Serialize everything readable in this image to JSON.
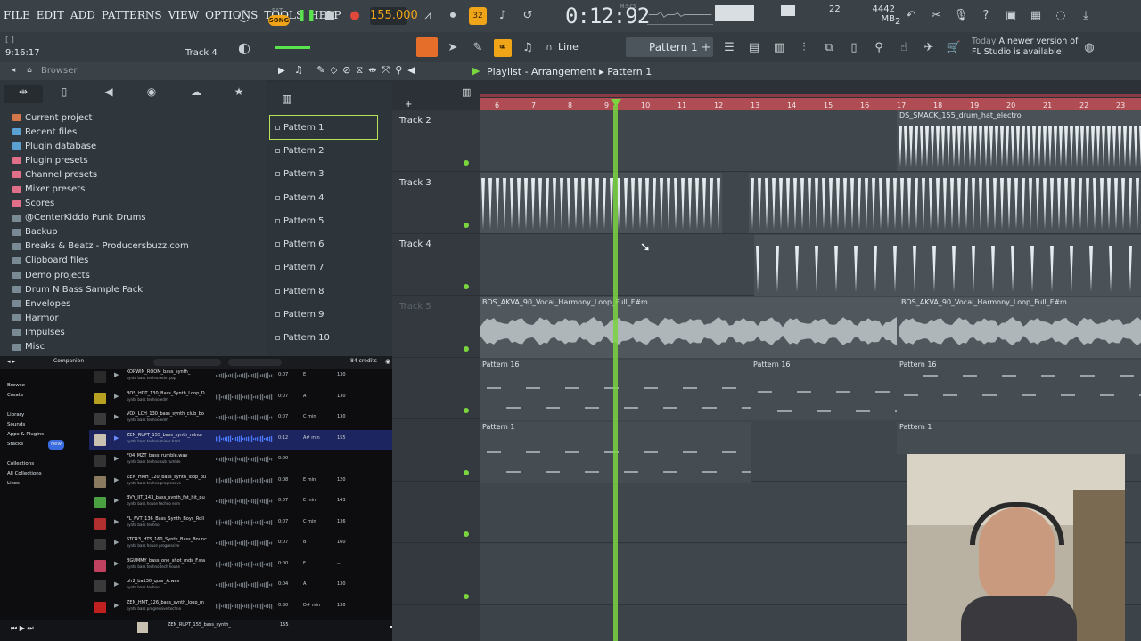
{
  "menu": [
    "FILE",
    "EDIT",
    "ADD",
    "PATTERNS",
    "VIEW",
    "OPTIONS",
    "TOOLS",
    "HELP"
  ],
  "transport": {
    "pat_label": "PAT",
    "song_label": "SONG",
    "tempo": "155.000",
    "time": "0:12:92",
    "time_unit": "M:S:CS",
    "mem": "4442 MB",
    "cpu_num": "22",
    "poly": "2"
  },
  "hint_bar": {
    "hint": "[ ]",
    "position": "9:16:17",
    "track": "Track 4"
  },
  "toolbar2": {
    "snap": "Line",
    "pattern": "Pattern 1"
  },
  "news": {
    "when": "Today",
    "text1": "A newer version of",
    "text2": "FL Studio is available!"
  },
  "browser": {
    "title": "Browser",
    "items": [
      {
        "label": "Current project",
        "color": "#d2784a"
      },
      {
        "label": "Recent files",
        "color": "#5aa0d0"
      },
      {
        "label": "Plugin database",
        "color": "#5aa0d0"
      },
      {
        "label": "Plugin presets",
        "color": "#e0708a"
      },
      {
        "label": "Channel presets",
        "color": "#e0708a"
      },
      {
        "label": "Mixer presets",
        "color": "#e0708a"
      },
      {
        "label": "Scores",
        "color": "#e0708a"
      },
      {
        "label": "@CenterKiddo Punk Drums",
        "color": "#7a8a94"
      },
      {
        "label": "Backup",
        "color": "#7a8a94"
      },
      {
        "label": "Breaks & Beatz - Producersbuzz.com",
        "color": "#7a8a94"
      },
      {
        "label": "Clipboard files",
        "color": "#7a8a94"
      },
      {
        "label": "Demo projects",
        "color": "#7a8a94"
      },
      {
        "label": "Drum N Bass Sample Pack",
        "color": "#7a8a94"
      },
      {
        "label": "Envelopes",
        "color": "#7a8a94"
      },
      {
        "label": "Harmor",
        "color": "#7a8a94"
      },
      {
        "label": "Impulses",
        "color": "#7a8a94"
      },
      {
        "label": "Misc",
        "color": "#7a8a94"
      }
    ]
  },
  "companion": {
    "title": "Companion",
    "credits": "84 credits",
    "nav": [
      "Browse",
      "Create",
      "",
      "Library",
      "Sounds",
      "Apps & Plugins",
      "Stacks",
      "",
      "Collections",
      "All Collections",
      "Likes"
    ],
    "new_badge": "New",
    "rows": [
      {
        "name": "KORWIN_ROOM_bass_synth_",
        "tags": "synth  bass  techno  edm  pop",
        "dur": "0:07",
        "key": "E",
        "bpm": "130",
        "thumb": "#2a2a2a",
        "sel": false
      },
      {
        "name": "BOS_HDT_130_Bass_Synth_Loop_D",
        "tags": "synth  bass  techno  edm",
        "dur": "0:07",
        "key": "A",
        "bpm": "130",
        "thumb": "#b8a020",
        "sel": false
      },
      {
        "name": "VOX_LCH_130_bass_synth_club_bo",
        "tags": "synth  bass  techno  edm",
        "dur": "0:07",
        "key": "C min",
        "bpm": "130",
        "thumb": "#3a3a3a",
        "sel": false
      },
      {
        "name": "ZEN_RUPT_155_bass_synth_minor",
        "tags": "synth  bass  techno  minor  hard",
        "dur": "0:12",
        "key": "A# min",
        "bpm": "155",
        "thumb": "#c8c0b0",
        "sel": true
      },
      {
        "name": "F04_MZT_bass_rumble.wav",
        "tags": "synth  bass  techno  sub  rumble",
        "dur": "0:00",
        "key": "--",
        "bpm": "--",
        "thumb": "#333333",
        "sel": false
      },
      {
        "name": "ZEN_HMH_120_bass_synth_loop_pu",
        "tags": "synth  bass  techno  progressive",
        "dur": "0:08",
        "key": "E min",
        "bpm": "120",
        "thumb": "#8a7a60",
        "sel": false
      },
      {
        "name": "BVY_IIT_143_bass_synth_fat_hit_pu",
        "tags": "synth  bass  house  techno  edm",
        "dur": "0:07",
        "key": "E min",
        "bpm": "143",
        "thumb": "#4aa040",
        "sel": false
      },
      {
        "name": "FL_PVT_136_Bass_Synth_Boys_Roll",
        "tags": "synth  bass  techno",
        "dur": "0:07",
        "key": "C min",
        "bpm": "136",
        "thumb": "#b03030",
        "sel": false
      },
      {
        "name": "STCR3_HTS_160_Synth_Bass_Bounc",
        "tags": "synth  bass  house  progressive",
        "dur": "0:07",
        "key": "B",
        "bpm": "160",
        "thumb": "#3a3a3a",
        "sel": false
      },
      {
        "name": "BGUMMY_bass_one_shot_mds_F.wa",
        "tags": "synth  bass  techno  tech house",
        "dur": "0:00",
        "key": "F",
        "bpm": "--",
        "thumb": "#c04060",
        "sel": false
      },
      {
        "name": "blr2_ba130_quar_A.wav",
        "tags": "synth  bass  techno",
        "dur": "0:04",
        "key": "A",
        "bpm": "130",
        "thumb": "#3a3a3a",
        "sel": false
      },
      {
        "name": "ZEN_HMT_126_bass_synth_loop_m",
        "tags": "synth  bass  progressive  techno",
        "dur": "0:30",
        "key": "D# min",
        "bpm": "130",
        "thumb": "#c02020",
        "sel": false
      }
    ],
    "footer_file": "ZEN_RUPT_155_bass_synth_",
    "footer_bpm": "155"
  },
  "playlist": {
    "title": "Playlist - Arrangement",
    "pattern": "Pattern 1",
    "patterns": [
      "Pattern 1",
      "Pattern 2",
      "Pattern 3",
      "Pattern 4",
      "Pattern 5",
      "Pattern 6",
      "Pattern 7",
      "Pattern 8",
      "Pattern 9",
      "Pattern 10"
    ],
    "tracks": [
      "Track 2",
      "Track 3",
      "Track 4",
      "Track 5",
      "",
      "",
      "",
      ""
    ],
    "ruler": [
      "6",
      "7",
      "8",
      "9",
      "10",
      "11",
      "12",
      "13",
      "14",
      "15",
      "16",
      "17",
      "18",
      "19",
      "20",
      "21",
      "22",
      "23"
    ],
    "clips": {
      "hat_a": "DS_SMACK_155_drum_hat_electro",
      "hat_b": "DS_SMACK_155_drum_hat",
      "vocal_a": "BOS_AKVA_90_Vocal_Harmony_Loop_Full_F#m",
      "vocal_b": "BOS_AKVA_90_Vocal_Harmony_Loop_Full_F#m",
      "pat16_a": "Pattern 16",
      "pat16_b": "Pattern 16",
      "pat16_c": "Pattern 16",
      "pat1_a": "Pattern 1",
      "pat1_b": "Pattern 1"
    }
  },
  "colors": {
    "accent_green": "#7ad53e",
    "ruler_red": "#b04c54",
    "orange": "#f0a418"
  }
}
